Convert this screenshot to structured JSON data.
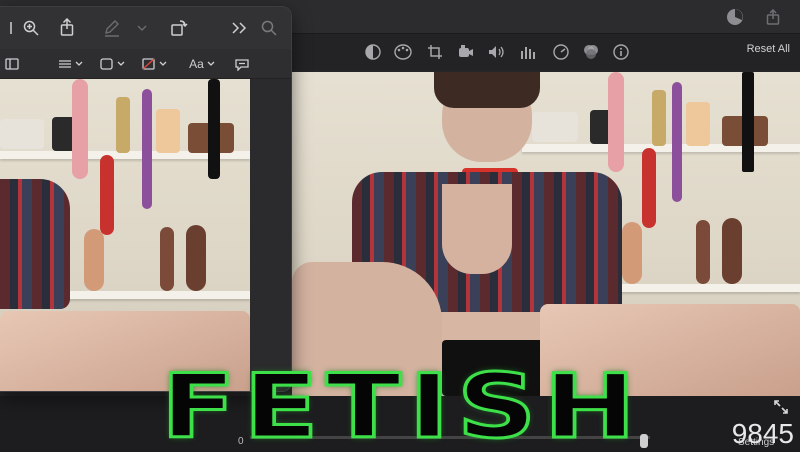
{
  "editor": {
    "toolbar_icons": [
      "crop-rotate-icon",
      "palette-icon",
      "crop-icon",
      "camera-icon",
      "volume-icon",
      "equalizer-icon",
      "speed-icon",
      "filters-icon",
      "info-icon"
    ],
    "reset_label": "Reset All",
    "timeline_start": "0",
    "settings_label": "Settings"
  },
  "markup": {
    "toolbar_icons": [
      "zoom-in-icon",
      "share-icon",
      "pen-icon",
      "rotate-icon",
      "more-icon",
      "search-icon"
    ],
    "format_label": "Aa"
  },
  "overlay": {
    "title": "FETISH",
    "counter": "9845"
  },
  "colors": {
    "title_outline": "#3ee04a",
    "title_fill": "#050505"
  }
}
